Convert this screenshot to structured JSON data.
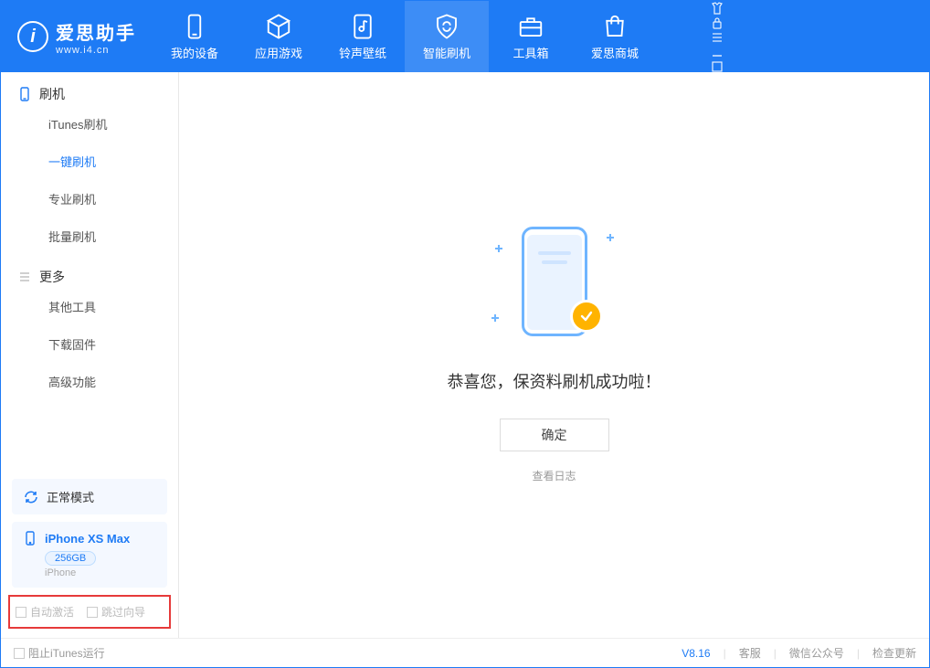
{
  "app": {
    "name_cn": "爱思助手",
    "name_en": "www.i4.cn",
    "logo_letter": "i"
  },
  "tabs": [
    {
      "label": "我的设备"
    },
    {
      "label": "应用游戏"
    },
    {
      "label": "铃声壁纸"
    },
    {
      "label": "智能刷机"
    },
    {
      "label": "工具箱"
    },
    {
      "label": "爱思商城"
    }
  ],
  "sidebar": {
    "sec1": "刷机",
    "items1": [
      {
        "label": "iTunes刷机"
      },
      {
        "label": "一键刷机"
      },
      {
        "label": "专业刷机"
      },
      {
        "label": "批量刷机"
      }
    ],
    "sec2": "更多",
    "items2": [
      {
        "label": "其他工具"
      },
      {
        "label": "下载固件"
      },
      {
        "label": "高级功能"
      }
    ]
  },
  "device": {
    "mode": "正常模式",
    "name": "iPhone XS Max",
    "capacity": "256GB",
    "type": "iPhone"
  },
  "options": {
    "auto_activate": "自动激活",
    "skip_guide": "跳过向导"
  },
  "main": {
    "success_msg": "恭喜您，保资料刷机成功啦！",
    "ok": "确定",
    "log": "查看日志"
  },
  "statusbar": {
    "block_itunes": "阻止iTunes运行",
    "version": "V8.16",
    "support": "客服",
    "wechat": "微信公众号",
    "update": "检查更新"
  }
}
